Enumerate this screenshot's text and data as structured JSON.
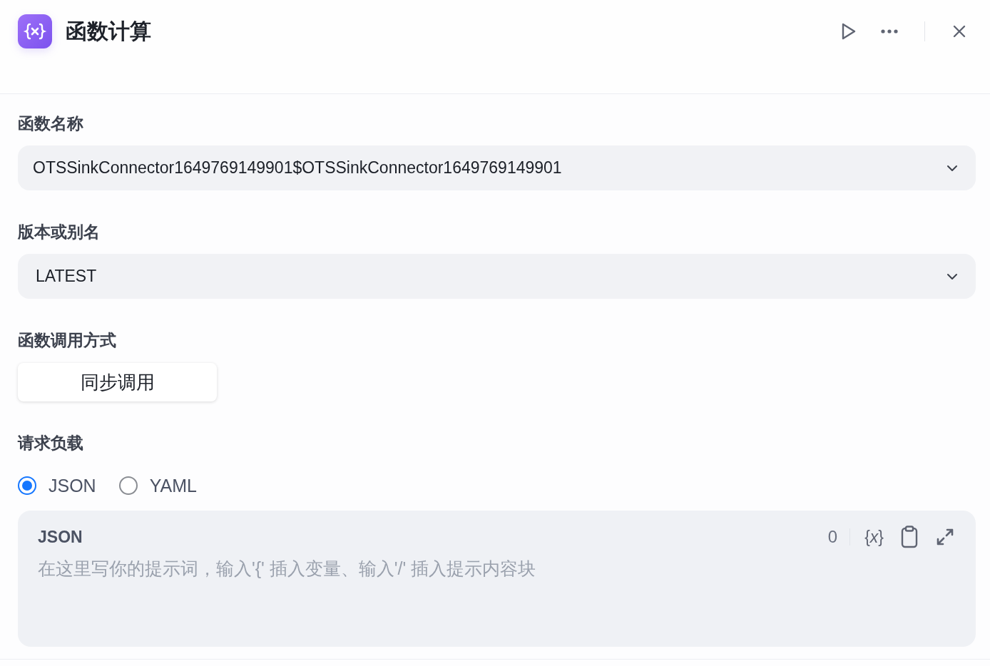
{
  "header": {
    "title": "函数计算",
    "actions": [
      {
        "kind": "run"
      },
      {
        "kind": "more"
      },
      {
        "kind": "close"
      }
    ]
  },
  "form": {
    "function_name": {
      "label": "函数名称",
      "value": "OTSSinkConnector1649769149901$OTSSinkConnector1649769149901"
    },
    "version": {
      "label": "版本或别名",
      "value": "LATEST"
    },
    "invocation_mode": {
      "label": "函数调用方式",
      "options": [
        {
          "label": "同步调用",
          "selected": true
        }
      ]
    },
    "payload": {
      "label": "请求负载",
      "formats": [
        {
          "label": "JSON",
          "selected": true
        },
        {
          "label": "YAML",
          "selected": false
        }
      ],
      "editor": {
        "title": "JSON",
        "placeholder": "在这里写你的提示词，输入'{' 插入变量、输入'/' 插入提示内容块",
        "char_count": "0",
        "variable_button": "{*x*}"
      }
    }
  }
}
